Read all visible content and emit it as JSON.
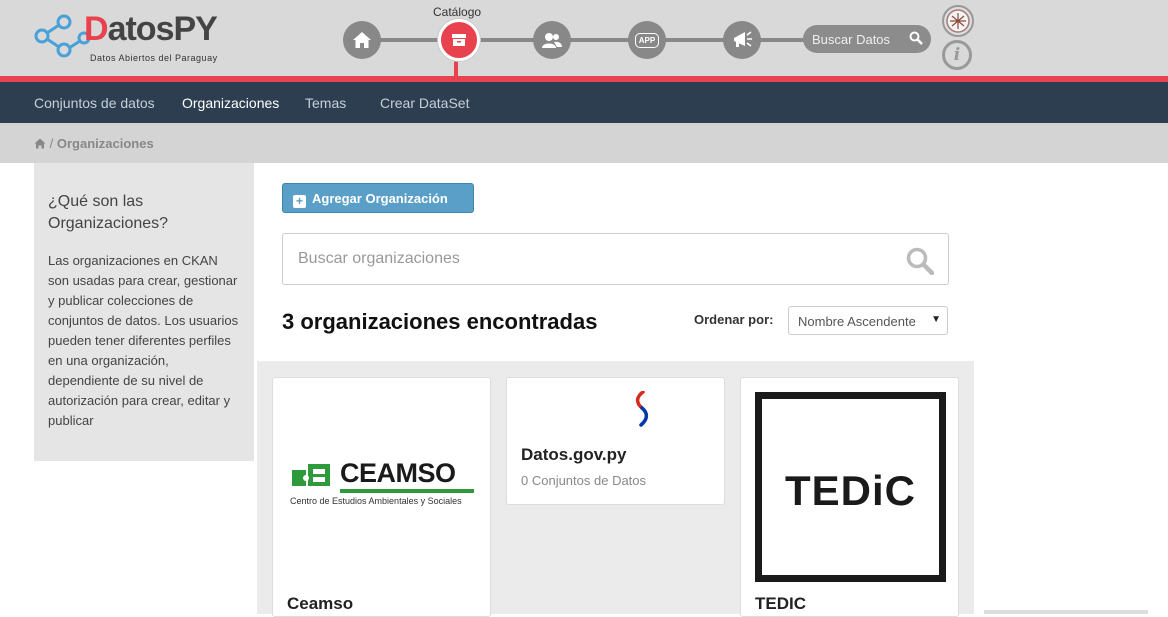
{
  "header": {
    "logo_text_1": "D",
    "logo_text_2": "atosPY",
    "logo_tagline": "Datos Abiertos del Paraguay",
    "active_step_caption": "Catálogo",
    "search_placeholder": "Buscar Datos",
    "info_glyph": "i",
    "app_label": "APP",
    "steps": [
      "home-icon",
      "catalog-icon",
      "users-icon",
      "app-icon",
      "megaphone-icon"
    ]
  },
  "nav": {
    "items": [
      "Conjuntos de datos",
      "Organizaciones",
      "Temas",
      "Crear DataSet"
    ],
    "active": "Organizaciones"
  },
  "breadcrumb": {
    "separator": "/",
    "current": "Organizaciones"
  },
  "sidebar": {
    "title": "¿Qué son las Organizaciones?",
    "body": "Las organizaciones en CKAN son usadas para crear, gestionar y publicar colecciones de conjuntos de datos. Los usuarios pueden tener diferentes perfiles en una organización, dependiente de su nivel de autorización para crear, editar y publicar"
  },
  "main": {
    "add_button": "Agregar Organización",
    "search_placeholder": "Buscar organizaciones",
    "result_count": "3 organizaciones encontradas",
    "sort_label": "Ordenar por:",
    "sort_value": "Nombre Ascendente",
    "organizations": [
      {
        "name": "Ceamso",
        "logo_text": "CEAMSO",
        "logo_subtitle": "Centro de Estudios Ambientales y Sociales"
      },
      {
        "name": "Datos.gov.py",
        "datasets": "0 Conjuntos de Datos"
      },
      {
        "name": "TEDIC",
        "logo_text": "TEDiC"
      }
    ]
  },
  "colors": {
    "accent_red": "#e8424f",
    "nav_bg": "#2d3e50",
    "button_blue": "#5a9fc8",
    "ceamso_green": "#2f9a3c"
  }
}
